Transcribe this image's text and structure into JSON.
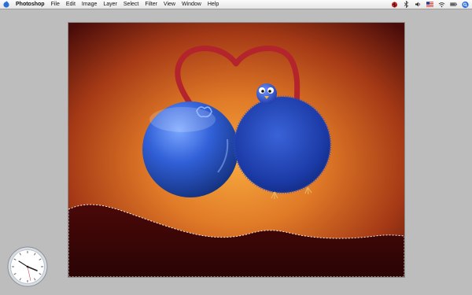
{
  "menubar": {
    "apple_icon": "apple-icon",
    "items": [
      "Photoshop",
      "File",
      "Edit",
      "Image",
      "Layer",
      "Select",
      "Filter",
      "View",
      "Window",
      "Help"
    ],
    "tray_icons": [
      "ladybug-icon",
      "bluetooth-icon",
      "volume-icon",
      "us-flag-icon",
      "wifi-icon",
      "battery-icon",
      "spotlight-icon"
    ]
  },
  "canvas": {
    "background_colors": [
      "#f5a23a",
      "#c04a17",
      "#4a0c0a"
    ],
    "heart_color": "#b3242c",
    "ball_color": "#2e5fd8",
    "fluffy_color": "#1d3fb0",
    "ground_color": "#3a0707",
    "selection": "marching-ants"
  },
  "clock": {
    "widget": "analog-clock-widget"
  }
}
